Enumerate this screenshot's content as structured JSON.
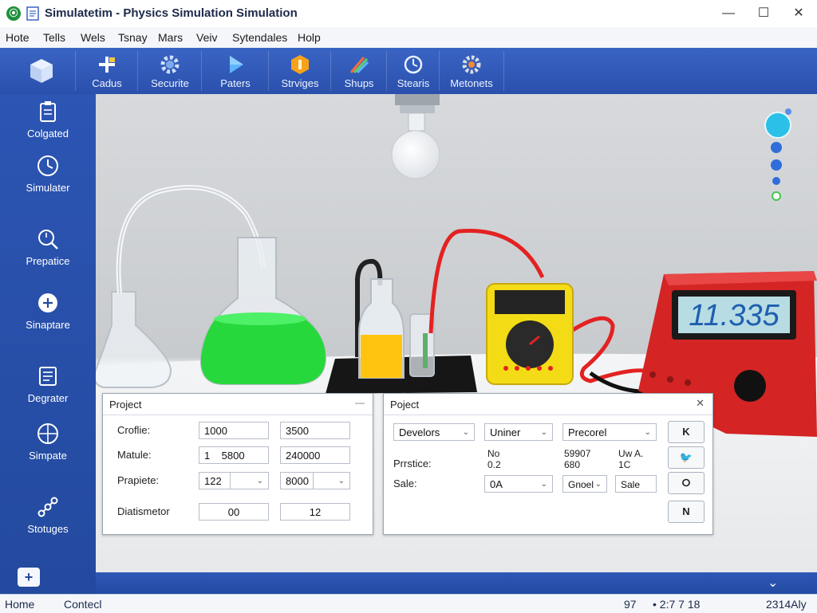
{
  "window": {
    "title": "Simulatetim - Physics Simulation Simulation",
    "minimize": "—",
    "maximize": "☐",
    "close": "✕"
  },
  "menu": [
    "Hote",
    "Tells",
    "Wels",
    "Tsnay",
    "Mars",
    "Veiv",
    "Sytendales",
    "Holp"
  ],
  "ribbon": [
    {
      "label": "",
      "icon": "cube-icon"
    },
    {
      "label": "Cadus",
      "icon": "plus-grid-icon"
    },
    {
      "label": "Securite",
      "icon": "gear-icon"
    },
    {
      "label": "Paters",
      "icon": "play-icon"
    },
    {
      "label": "Strviges",
      "icon": "hexagon-icon"
    },
    {
      "label": "Shups",
      "icon": "chart-icon"
    },
    {
      "label": "Stearis",
      "icon": "timer-icon"
    },
    {
      "label": "Metonets",
      "icon": "cog-icon"
    }
  ],
  "sidebar": [
    {
      "label": "Colgated",
      "icon": "clipboard-icon"
    },
    {
      "label": "Simulater",
      "icon": "clock-icon"
    },
    {
      "label": "Prepatice",
      "icon": "magnifier-icon"
    },
    {
      "label": "Sinaptare",
      "icon": "plus-circle-icon"
    },
    {
      "label": "Degrater",
      "icon": "document-icon"
    },
    {
      "label": "Simpate",
      "icon": "globe-icon"
    },
    {
      "label": "Stotuges",
      "icon": "nodes-icon"
    }
  ],
  "sidebar_add": "+",
  "scene": {
    "display_reading": "11.335"
  },
  "panel_left": {
    "title": "Project",
    "collapse": "—",
    "rows": [
      {
        "label": "Croflie:",
        "v1": "1000",
        "v2": "3500"
      },
      {
        "label": "Matule:",
        "v1": "1    5800",
        "v2": "240000"
      },
      {
        "label": "Prapiete:",
        "v1": "122",
        "v2": "8000"
      },
      {
        "label": "Diatismetor",
        "v1": "00",
        "v2": "12"
      }
    ]
  },
  "panel_right": {
    "title": "Poject",
    "close": "✕",
    "dropdowns": [
      "Develors",
      "Uniner",
      "Precorel"
    ],
    "label_practice": "Prrstice:",
    "label_sale": "Sale:",
    "col1_top": "No",
    "col1_sub": "0.2",
    "col2_top": "59907",
    "col2_sub": "680",
    "col3_top": "Uw A.",
    "col3_sub": "1C",
    "sale_select": "0A",
    "sale_option": "Gnoel",
    "sale_value": "Sale",
    "buttons": [
      "K",
      "🐦",
      "⭘",
      "N"
    ]
  },
  "lowerbar": {
    "chevron": "⌄"
  },
  "status": {
    "left1": "Home",
    "left2": "Contecl",
    "mid1": "97",
    "mid2": "•  2:7 7 18",
    "right": "2314Aly"
  },
  "colors": {
    "brand_blue": "#2a50ac",
    "liquid_green": "#26d83c",
    "liquid_yellow": "#ffc40f",
    "multimeter_yellow": "#f3dc15",
    "device_red": "#d42424"
  }
}
